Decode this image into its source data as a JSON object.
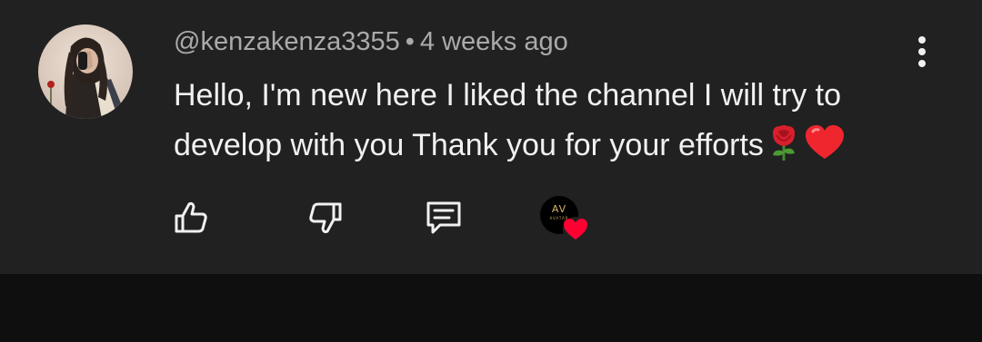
{
  "comment": {
    "username": "@kenzakenza3355",
    "separator": "•",
    "timestamp": "4 weeks ago",
    "text": "Hello, I'm new here I liked the channel I will try to develop with you Thank you for your efforts",
    "emojis": [
      "rose",
      "red-heart"
    ]
  },
  "creator_avatar": {
    "monogram": "AV",
    "subtext": "AVATAR"
  },
  "colors": {
    "card_background": "#212121",
    "page_background": "#0f0f0f",
    "primary_text": "#f1f1f1",
    "secondary_text": "#aaaaaa",
    "heart_red": "#ff0033"
  },
  "icons": [
    "thumbs-up-icon",
    "thumbs-down-icon",
    "reply-icon",
    "more-vert-icon",
    "heart-icon"
  ]
}
